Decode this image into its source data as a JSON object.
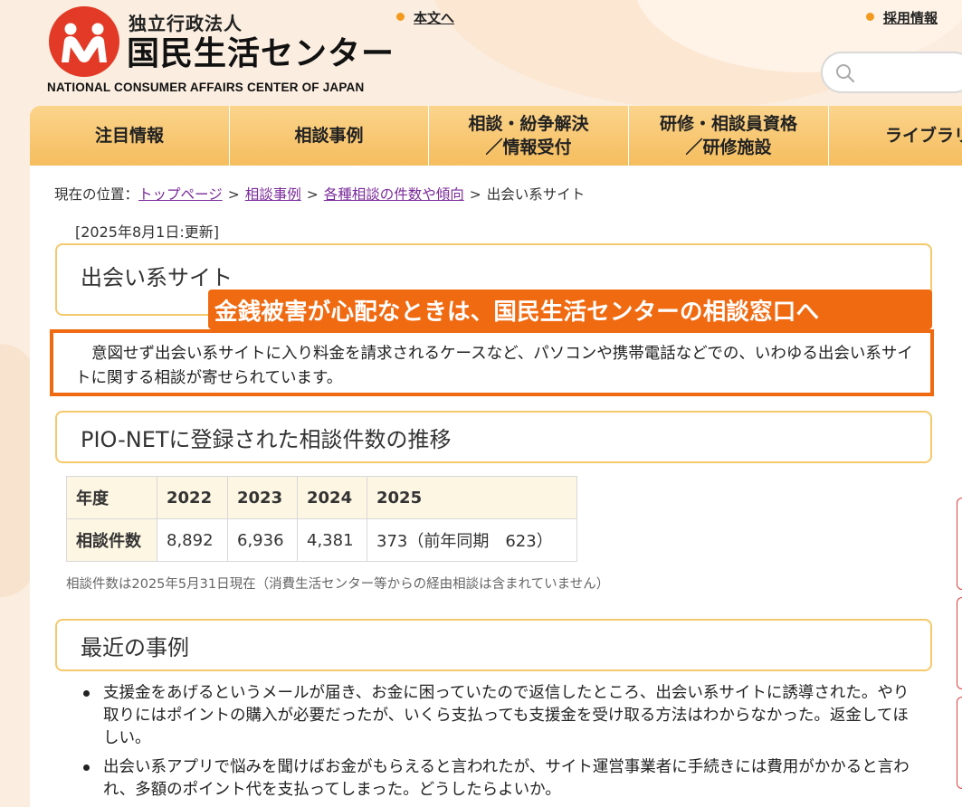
{
  "header": {
    "logo_sub": "独立行政法人",
    "logo_main": "国民生活センター",
    "logo_en": "NATIONAL CONSUMER AFFAIRS CENTER OF JAPAN",
    "links": {
      "main_text": "本文へ",
      "recruit": "採用情報"
    },
    "search": {
      "placeholder": ""
    },
    "colors": {
      "brand": "#e23a26",
      "accent": "#f39a1e",
      "nav": "#f8c66f"
    }
  },
  "nav": [
    {
      "label": "注目情報"
    },
    {
      "label": "相談事例"
    },
    {
      "label": "相談・紛争解決\n／情報受付"
    },
    {
      "label": "研修・相談員資格\n／研修施設"
    },
    {
      "label": "ライブラリ"
    }
  ],
  "breadcrumb": {
    "prefix": "現在の位置：",
    "items": [
      "トップページ",
      "相談事例",
      "各種相談の件数や傾向"
    ],
    "current": "出会い系サイト",
    "sep": ">"
  },
  "page": {
    "updated": "[2025年8月1日:更新]",
    "title": "出会い系サイト",
    "banner": "金銭被害が心配なときは、国民生活センターの相談窓口へ",
    "intro": "意図せず出会い系サイトに入り料金を請求されるケースなど、パソコンや携帯電話などでの、いわゆる出会い系サイトに関する相談が寄せられています。"
  },
  "stats": {
    "heading": "PIO-NETに登録された相談件数の推移",
    "header_row": [
      "年度",
      "2022",
      "2023",
      "2024",
      "2025"
    ],
    "data_row": [
      "相談件数",
      "8,892",
      "6,936",
      "4,381",
      "373（前年同期　623）"
    ],
    "note": "相談件数は2025年5月31日現在（消費生活センター等からの経由相談は含まれていません）"
  },
  "recent": {
    "heading": "最近の事例",
    "cases": [
      "支援金をあげるというメールが届き、お金に困っていたので返信したところ、出会い系サイトに誘導された。やり取りにはポイントの購入が必要だったが、いくら支払っても支援金を受け取る方法はわからなかった。返金してほしい。",
      "出会い系アプリで悩みを聞けばお金がもらえると言われたが、サイト運営事業者に手続きには費用がかかると言われ、多額のポイント代を支払ってしまった。どうしたらよいか。"
    ]
  }
}
